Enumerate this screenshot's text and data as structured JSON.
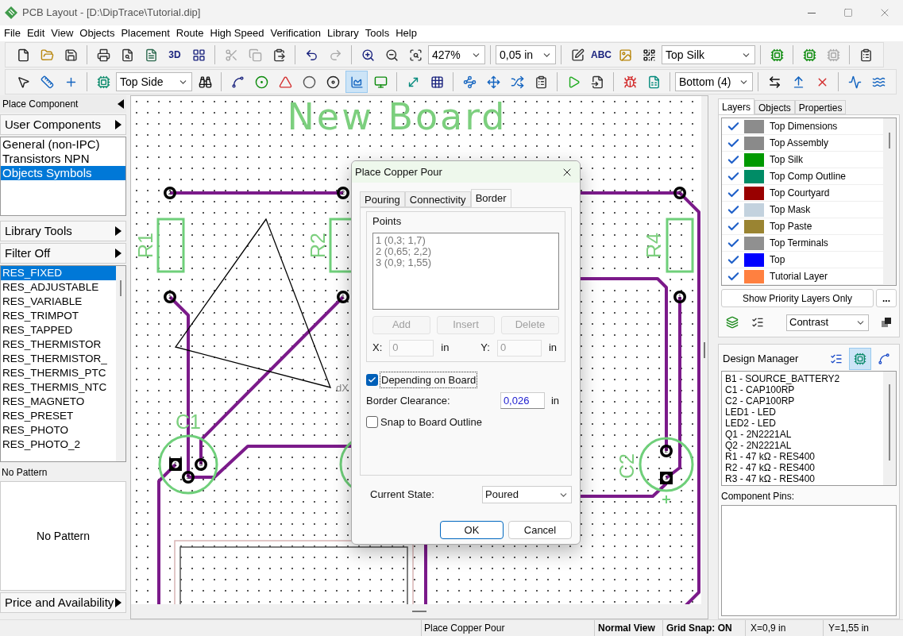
{
  "window": {
    "title": "PCB Layout - [D:\\DipTrace\\Tutorial.dip]"
  },
  "menu": [
    "File",
    "Edit",
    "View",
    "Objects",
    "Placement",
    "Route",
    "High Speed",
    "Verification",
    "Library",
    "Tools",
    "Help"
  ],
  "toolbar_1": [
    {
      "kind": "icon",
      "disabled": false,
      "selected": false
    },
    {
      "kind": "icon",
      "disabled": false,
      "selected": false
    },
    {
      "kind": "icon",
      "disabled": false,
      "selected": false
    },
    {
      "kind": "separator"
    },
    {
      "kind": "icon",
      "disabled": false,
      "selected": false
    },
    {
      "kind": "icon",
      "disabled": false,
      "selected": false
    },
    {
      "kind": "icon",
      "disabled": false,
      "selected": false
    },
    {
      "kind": "text",
      "label": "3D",
      "disabled": false,
      "selected": false
    },
    {
      "kind": "icon",
      "disabled": false,
      "selected": false
    },
    {
      "kind": "separator"
    },
    {
      "kind": "icon",
      "disabled": true,
      "selected": false
    },
    {
      "kind": "icon",
      "disabled": true,
      "selected": false
    },
    {
      "kind": "icon",
      "disabled": false,
      "selected": false
    },
    {
      "kind": "separator"
    },
    {
      "kind": "icon",
      "disabled": false,
      "selected": false
    },
    {
      "kind": "icon",
      "disabled": true,
      "selected": false
    },
    {
      "kind": "separator"
    },
    {
      "kind": "icon",
      "disabled": false,
      "selected": false
    },
    {
      "kind": "icon",
      "disabled": false,
      "selected": false
    },
    {
      "kind": "icon",
      "disabled": false,
      "selected": false
    },
    {
      "kind": "combo",
      "value": "427%"
    },
    {
      "kind": "separator"
    },
    {
      "kind": "combo",
      "value": "0,05 in"
    },
    {
      "kind": "separator"
    },
    {
      "kind": "icon",
      "disabled": false,
      "selected": false
    },
    {
      "kind": "text",
      "label": "ABC",
      "disabled": false,
      "selected": false
    },
    {
      "kind": "icon",
      "disabled": false,
      "selected": false
    },
    {
      "kind": "icon",
      "disabled": false,
      "selected": false
    },
    {
      "kind": "combo",
      "value": "Top Silk"
    },
    {
      "kind": "separator"
    },
    {
      "kind": "icon",
      "disabled": false,
      "selected": false
    },
    {
      "kind": "separator"
    },
    {
      "kind": "icon",
      "disabled": false,
      "selected": false
    },
    {
      "kind": "icon",
      "disabled": true,
      "selected": false
    },
    {
      "kind": "separator"
    },
    {
      "kind": "icon",
      "disabled": false,
      "selected": false
    }
  ],
  "toolbar_2": [
    {
      "kind": "icon",
      "disabled": false,
      "selected": false
    },
    {
      "kind": "icon",
      "disabled": false,
      "selected": false
    },
    {
      "kind": "icon",
      "disabled": false,
      "selected": false
    },
    {
      "kind": "separator"
    },
    {
      "kind": "icon",
      "disabled": false,
      "selected": false
    },
    {
      "kind": "combo",
      "value": "Top Side"
    },
    {
      "kind": "icon",
      "disabled": false,
      "selected": false
    },
    {
      "kind": "separator"
    },
    {
      "kind": "icon",
      "disabled": false,
      "selected": false
    },
    {
      "kind": "icon",
      "disabled": false,
      "selected": false
    },
    {
      "kind": "icon",
      "disabled": false,
      "selected": false
    },
    {
      "kind": "icon",
      "disabled": false,
      "selected": false
    },
    {
      "kind": "icon",
      "disabled": false,
      "selected": false
    },
    {
      "kind": "icon",
      "disabled": false,
      "selected": true
    },
    {
      "kind": "icon",
      "disabled": false,
      "selected": false
    },
    {
      "kind": "separator"
    },
    {
      "kind": "icon",
      "disabled": false,
      "selected": false
    },
    {
      "kind": "icon",
      "disabled": false,
      "selected": false
    },
    {
      "kind": "separator"
    },
    {
      "kind": "icon",
      "disabled": false,
      "selected": false
    },
    {
      "kind": "icon",
      "disabled": false,
      "selected": false
    },
    {
      "kind": "icon",
      "disabled": false,
      "selected": false
    },
    {
      "kind": "icon",
      "disabled": false,
      "selected": false
    },
    {
      "kind": "separator"
    },
    {
      "kind": "icon",
      "disabled": false,
      "selected": false
    },
    {
      "kind": "icon",
      "disabled": false,
      "selected": false
    },
    {
      "kind": "separator"
    },
    {
      "kind": "icon",
      "disabled": false,
      "selected": false
    },
    {
      "kind": "icon",
      "disabled": false,
      "selected": false
    },
    {
      "kind": "separator"
    },
    {
      "kind": "combo",
      "value": "Bottom (4)"
    },
    {
      "kind": "separator"
    },
    {
      "kind": "icon",
      "disabled": false,
      "selected": false
    },
    {
      "kind": "icon",
      "disabled": false,
      "selected": false
    },
    {
      "kind": "icon",
      "disabled": false,
      "selected": false
    },
    {
      "kind": "separator"
    },
    {
      "kind": "icon",
      "disabled": false,
      "selected": false
    },
    {
      "kind": "icon",
      "disabled": false,
      "selected": false
    }
  ],
  "left_panel": {
    "header": "Place Component",
    "library_button": "User Components",
    "libraries": [
      {
        "label": "General (non-IPC)",
        "selected": false
      },
      {
        "label": "Transistors NPN",
        "selected": false
      },
      {
        "label": "Objects Symbols",
        "selected": true
      }
    ],
    "tools_button": "Library Tools",
    "filter_button": "Filter Off",
    "components": [
      {
        "label": "RES_FIXED",
        "selected": true
      },
      {
        "label": "RES_ADJUSTABLE",
        "selected": false
      },
      {
        "label": "RES_VARIABLE",
        "selected": false
      },
      {
        "label": "RES_TRIMPOT",
        "selected": false
      },
      {
        "label": "RES_TAPPED",
        "selected": false
      },
      {
        "label": "RES_THERMISTOR",
        "selected": false
      },
      {
        "label": "RES_THERMISTOR_",
        "selected": false
      },
      {
        "label": "RES_THERMIS_PTC",
        "selected": false
      },
      {
        "label": "RES_THERMIS_NTC",
        "selected": false
      },
      {
        "label": "RES_MAGNETO",
        "selected": false
      },
      {
        "label": "RES_PRESET",
        "selected": false
      },
      {
        "label": "RES_PHOTO",
        "selected": false
      },
      {
        "label": "RES_PHOTO_2",
        "selected": false
      }
    ],
    "pattern_label": "No Pattern",
    "pattern_preview": "No Pattern",
    "price_button": "Price and Availability"
  },
  "canvas": {
    "title": "New Board",
    "labels": [
      "R1",
      "R2",
      "R4",
      "C1",
      "C2"
    ],
    "marker": "dX",
    "pads": [
      {
        "label": "2",
        "kind": "round"
      },
      {
        "label": "2",
        "kind": "round"
      },
      {
        "label": "2",
        "kind": "round"
      },
      {
        "label": "1",
        "kind": "round"
      },
      {
        "label": "1",
        "kind": "round"
      },
      {
        "label": "1",
        "kind": "round"
      },
      {
        "label": "1",
        "kind": "square"
      },
      {
        "label": "3",
        "kind": "round"
      },
      {
        "label": "2",
        "kind": "round"
      },
      {
        "label": "2",
        "kind": "round"
      },
      {
        "label": "1",
        "kind": "square"
      }
    ]
  },
  "dialog": {
    "title": "Place Copper Pour",
    "tabs": [
      {
        "label": "Pouring",
        "selected": false
      },
      {
        "label": "Connectivity",
        "selected": false
      },
      {
        "label": "Border",
        "selected": true
      }
    ],
    "points_group": "Points",
    "points": [
      "1 (0,3; 1,7)",
      "2 (0,65; 2,2)",
      "3 (0,9; 1,55)"
    ],
    "point_buttons": [
      {
        "label": "Add",
        "disabled": true
      },
      {
        "label": "Insert",
        "disabled": true
      },
      {
        "label": "Delete",
        "disabled": true
      }
    ],
    "coords": [
      {
        "label": "X:",
        "value": "0",
        "unit": "in",
        "disabled": true
      },
      {
        "label": "Y:",
        "value": "0",
        "unit": "in",
        "disabled": true
      }
    ],
    "depending_on_board": {
      "label": "Depending on Board",
      "checked": true
    },
    "clearance": {
      "label": "Border Clearance:",
      "value": "0,026",
      "unit": "in"
    },
    "snap": {
      "label": "Snap to Board Outline",
      "checked": false
    },
    "state": {
      "label": "Current State:",
      "value": "Poured"
    },
    "buttons": [
      "OK",
      "Cancel"
    ]
  },
  "right_panel": {
    "tabs": [
      {
        "label": "Layers",
        "selected": true
      },
      {
        "label": "Objects",
        "selected": false
      },
      {
        "label": "Properties",
        "selected": false
      }
    ],
    "layers": [
      {
        "name": "Top Dimensions",
        "checked": true,
        "color": "#8c8c8c"
      },
      {
        "name": "Top Assembly",
        "checked": true,
        "color": "#8a8a8a"
      },
      {
        "name": "Top Silk",
        "checked": true,
        "color": "#009900"
      },
      {
        "name": "Top Comp Outline",
        "checked": true,
        "color": "#008c66"
      },
      {
        "name": "Top Courtyard",
        "checked": true,
        "color": "#990000"
      },
      {
        "name": "Top Mask",
        "checked": true,
        "color": "#c3d2de"
      },
      {
        "name": "Top Paste",
        "checked": true,
        "color": "#9a8432"
      },
      {
        "name": "Top Terminals",
        "checked": true,
        "color": "#909090"
      },
      {
        "name": "Top",
        "checked": true,
        "color": "#0000ff"
      },
      {
        "name": "Tutorial Layer",
        "checked": true,
        "color": "#ff8040"
      }
    ],
    "priority_button": "Show Priority Layers Only",
    "more_button": "...",
    "contrast": "Contrast",
    "design_manager": "Design Manager",
    "view_buttons": [
      {
        "selected": false
      },
      {
        "selected": true
      },
      {
        "selected": false
      }
    ],
    "components": [
      "B1 - SOURCE_BATTERY2",
      "C1 - CAP100RP",
      "C2 - CAP100RP",
      "LED1 - LED",
      "LED2 - LED",
      "Q1 - 2N2221AL",
      "Q2 - 2N2221AL",
      "R1 - 47 kΩ - RES400",
      "R2 - 47 kΩ - RES400",
      "R3 - 47 kΩ - RES400"
    ],
    "pins_label": "Component Pins:"
  },
  "status_bar": {
    "hint": "Place Copper Pour",
    "view": "Normal View",
    "grid_snap": "Grid Snap: ON",
    "x": "X=0,9 in",
    "y": "Y=1,55 in"
  }
}
